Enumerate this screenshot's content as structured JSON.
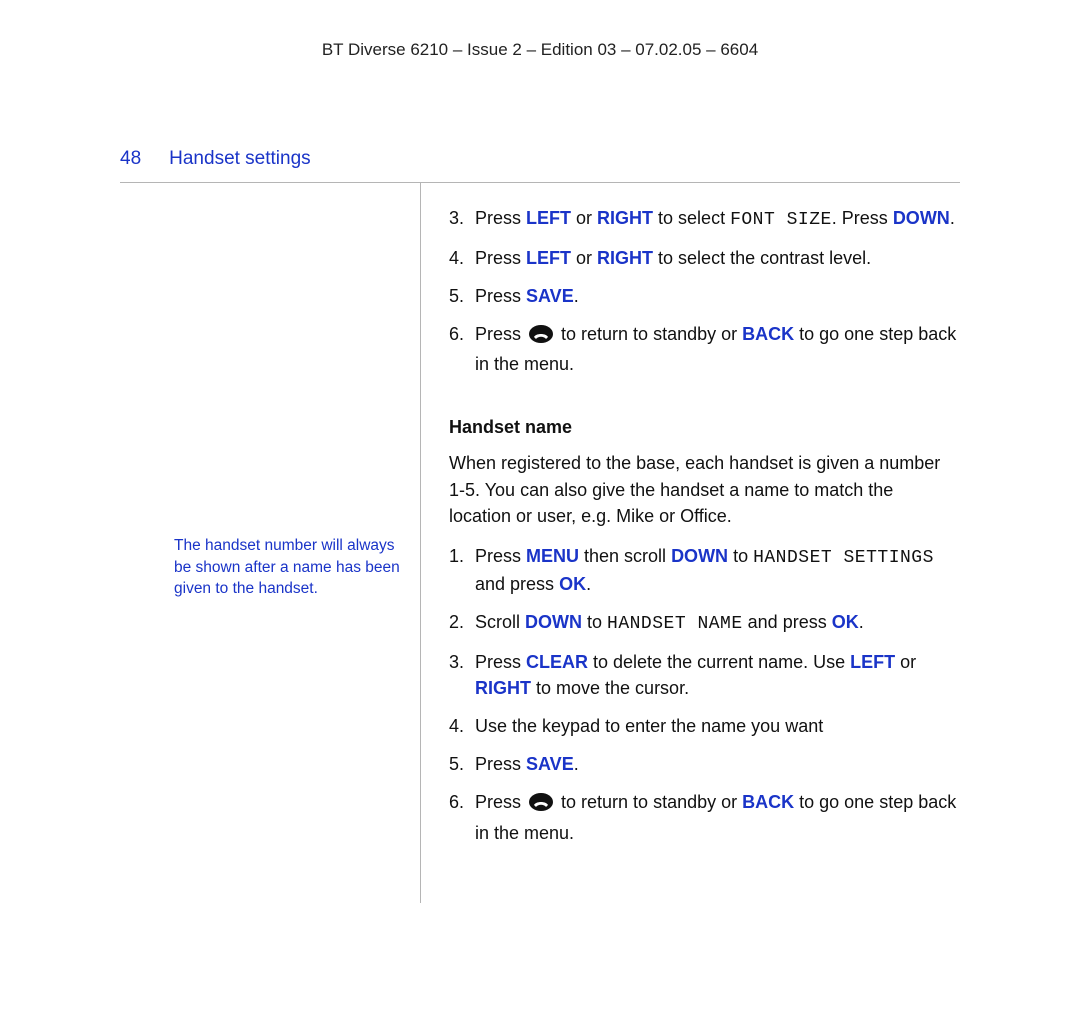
{
  "doc_header": "BT Diverse 6210 – Issue 2 – Edition 03 – 07.02.05 – 6604",
  "page_number": "48",
  "section_title": "Handset settings",
  "side_note": "The handset number will always be shown after a name has been given to the handset.",
  "keys": {
    "left": "LEFT",
    "right": "RIGHT",
    "down": "DOWN",
    "save": "SAVE",
    "back": "BACK",
    "menu": "MENU",
    "ok": "OK",
    "clear": "CLEAR"
  },
  "screens": {
    "font_size": "FONT SIZE",
    "handset_settings": "HANDSET SETTINGS",
    "handset_name": "HANDSET NAME"
  },
  "list_a": {
    "start": 3,
    "i3_a": "Press ",
    "i3_b": " or ",
    "i3_c": " to select ",
    "i3_d": ". Press ",
    "i3_e": ".",
    "i4_a": "Press ",
    "i4_b": " or ",
    "i4_c": " to select the contrast level.",
    "i5_a": "Press ",
    "i5_b": ".",
    "i6_a": "Press ",
    "i6_b": " to return to standby or ",
    "i6_c": " to go one step back in the menu."
  },
  "handset_name_heading": "Handset name",
  "handset_name_intro": "When registered to the base, each handset is given a number 1-5. You can also give the handset a name to match the location or user, e.g. Mike or Office.",
  "list_b": {
    "i1_a": "Press ",
    "i1_b": " then scroll ",
    "i1_c": " to ",
    "i1_d": " and press ",
    "i1_e": ".",
    "i2_a": "Scroll ",
    "i2_b": " to ",
    "i2_c": " and press ",
    "i2_d": ".",
    "i3_a": "Press ",
    "i3_b": " to delete the current name. Use ",
    "i3_c": " or ",
    "i3_d": " to move the cursor.",
    "i4": "Use the keypad to enter the name you want",
    "i5_a": "Press ",
    "i5_b": ".",
    "i6_a": "Press ",
    "i6_b": " to return to standby or ",
    "i6_c": " to go one step back in the menu."
  },
  "list_numbers": {
    "n1": "1.",
    "n2": "2.",
    "n3": "3.",
    "n4": "4.",
    "n5": "5.",
    "n6": "6."
  }
}
